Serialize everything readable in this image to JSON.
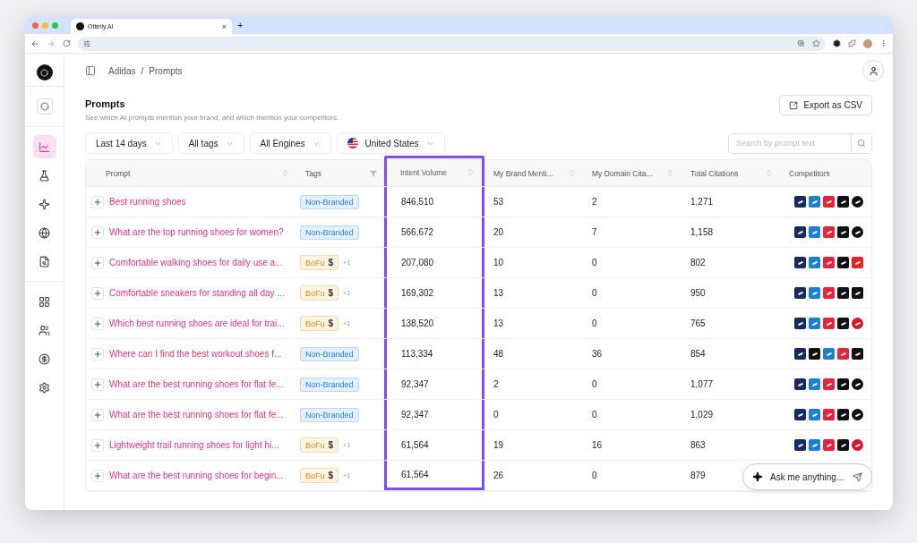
{
  "browser": {
    "tab_title": "Otterly.AI",
    "tab_close": "×",
    "new_tab": "+"
  },
  "sidebar": {
    "items": [
      {
        "selected": false
      },
      {
        "selected": true
      },
      {
        "selected": false
      },
      {
        "selected": false
      },
      {
        "selected": false
      },
      {
        "selected": false
      },
      {
        "selected": false
      },
      {
        "selected": false
      },
      {
        "selected": false
      },
      {
        "selected": false
      }
    ]
  },
  "breadcrumb": [
    {
      "label": "Adidas"
    },
    {
      "label": "/"
    },
    {
      "label": "Prompts"
    }
  ],
  "page": {
    "title": "Prompts",
    "subtitle": "See which AI prompts mention your brand, and which mention your competitors.",
    "export_button": "Export as CSV"
  },
  "filters": [
    {
      "label": "Last 14 days",
      "kind": "dropdown"
    },
    {
      "label": "All tags",
      "kind": "dropdown"
    },
    {
      "label": "All Engines",
      "kind": "dropdown"
    },
    {
      "label": "United States",
      "kind": "country"
    }
  ],
  "search": {
    "placeholder": "Search by prompt text"
  },
  "table": {
    "columns": [
      {
        "label": "Prompt",
        "kind": "sort",
        "highlighted": false
      },
      {
        "label": "Tags",
        "kind": "filter",
        "highlighted": false
      },
      {
        "label": "Intent Volume",
        "kind": "sort",
        "highlighted": true
      },
      {
        "label": "My Brand Menti...",
        "kind": "sort",
        "highlighted": false
      },
      {
        "label": "My Domain Cita...",
        "kind": "sort",
        "highlighted": false
      },
      {
        "label": "Total Citations",
        "kind": "sort",
        "highlighted": false
      },
      {
        "label": "Competitors",
        "kind": "none",
        "highlighted": false
      }
    ],
    "rows": [
      {
        "prompt": "Best running shoes",
        "tag": {
          "label": "Non-Branded",
          "kind": "non-branded"
        },
        "intent_volume": "846,510",
        "brand_mentions": "53",
        "domain_citations": "2",
        "total_citations": "1,271",
        "competitors": [
          {
            "color": "#1b2a5e",
            "kind": "square"
          },
          {
            "color": "#1d7fd0",
            "kind": "square"
          },
          {
            "color": "#e3243b",
            "kind": "square"
          },
          {
            "color": "#111111",
            "kind": "square"
          },
          {
            "color": "#111111",
            "kind": "circle"
          }
        ]
      },
      {
        "prompt": "What are the top running shoes for women?",
        "tag": {
          "label": "Non-Branded",
          "kind": "non-branded"
        },
        "intent_volume": "566,672",
        "brand_mentions": "20",
        "domain_citations": "7",
        "total_citations": "1,158",
        "competitors": [
          {
            "color": "#1b2a5e",
            "kind": "square"
          },
          {
            "color": "#1d7fd0",
            "kind": "square"
          },
          {
            "color": "#e3243b",
            "kind": "square"
          },
          {
            "color": "#111111",
            "kind": "square"
          },
          {
            "color": "#111111",
            "kind": "circle"
          }
        ]
      },
      {
        "prompt": "Comfortable walking shoes for daily use a...",
        "tag": {
          "label": "BoFu",
          "kind": "bofu",
          "symbol": "$"
        },
        "extra": "+1",
        "intent_volume": "207,080",
        "brand_mentions": "10",
        "domain_citations": "0",
        "total_citations": "802",
        "competitors": [
          {
            "color": "#1b2a5e",
            "kind": "square"
          },
          {
            "color": "#1d7fd0",
            "kind": "square"
          },
          {
            "color": "#e3243b",
            "kind": "square"
          },
          {
            "color": "#111111",
            "kind": "square"
          },
          {
            "color": "#e52320",
            "kind": "square"
          }
        ]
      },
      {
        "prompt": "Comfortable sneakers for standing all day ...",
        "tag": {
          "label": "BoFu",
          "kind": "bofu",
          "symbol": "$"
        },
        "extra": "+1",
        "intent_volume": "169,302",
        "brand_mentions": "13",
        "domain_citations": "0",
        "total_citations": "950",
        "competitors": [
          {
            "color": "#1b2a5e",
            "kind": "square"
          },
          {
            "color": "#1d7fd0",
            "kind": "square"
          },
          {
            "color": "#e3243b",
            "kind": "square"
          },
          {
            "color": "#111111",
            "kind": "square"
          },
          {
            "color": "#111111",
            "kind": "square"
          }
        ]
      },
      {
        "prompt": "Which best running shoes are ideal for trai...",
        "tag": {
          "label": "BoFu",
          "kind": "bofu",
          "symbol": "$"
        },
        "extra": "+1",
        "intent_volume": "138,520",
        "brand_mentions": "13",
        "domain_citations": "0",
        "total_citations": "765",
        "competitors": [
          {
            "color": "#1b2a5e",
            "kind": "square"
          },
          {
            "color": "#1d7fd0",
            "kind": "square"
          },
          {
            "color": "#e3243b",
            "kind": "square"
          },
          {
            "color": "#111111",
            "kind": "square"
          },
          {
            "color": "#d9172b",
            "kind": "circle"
          }
        ]
      },
      {
        "prompt": "Where can I find the best workout shoes f...",
        "tag": {
          "label": "Non-Branded",
          "kind": "non-branded"
        },
        "intent_volume": "113,334",
        "brand_mentions": "48",
        "domain_citations": "36",
        "total_citations": "854",
        "competitors": [
          {
            "color": "#1b2a5e",
            "kind": "square"
          },
          {
            "color": "#111111",
            "kind": "square"
          },
          {
            "color": "#1d7fd0",
            "kind": "square"
          },
          {
            "color": "#e3243b",
            "kind": "square"
          },
          {
            "color": "#111111",
            "kind": "square"
          }
        ]
      },
      {
        "prompt": "What are the best running shoes for flat fe...",
        "tag": {
          "label": "Non-Branded",
          "kind": "non-branded"
        },
        "intent_volume": "92,347",
        "brand_mentions": "2",
        "domain_citations": "0",
        "total_citations": "1,077",
        "competitors": [
          {
            "color": "#1b2a5e",
            "kind": "square"
          },
          {
            "color": "#1d7fd0",
            "kind": "square"
          },
          {
            "color": "#e3243b",
            "kind": "square"
          },
          {
            "color": "#111111",
            "kind": "square"
          },
          {
            "color": "#111111",
            "kind": "circle"
          }
        ]
      },
      {
        "prompt": "What are the best running shoes for flat fe...",
        "tag": {
          "label": "Non-Branded",
          "kind": "non-branded"
        },
        "intent_volume": "92,347",
        "brand_mentions": "0",
        "domain_citations": "0",
        "total_citations": "1,029",
        "competitors": [
          {
            "color": "#1b2a5e",
            "kind": "square"
          },
          {
            "color": "#1d7fd0",
            "kind": "square"
          },
          {
            "color": "#e3243b",
            "kind": "square"
          },
          {
            "color": "#111111",
            "kind": "square"
          },
          {
            "color": "#111111",
            "kind": "circle"
          }
        ]
      },
      {
        "prompt": "Lightweight trail running shoes for light hi...",
        "tag": {
          "label": "BoFu",
          "kind": "bofu",
          "symbol": "$"
        },
        "extra": "+1",
        "intent_volume": "61,564",
        "brand_mentions": "19",
        "domain_citations": "16",
        "total_citations": "863",
        "competitors": [
          {
            "color": "#1b2a5e",
            "kind": "square"
          },
          {
            "color": "#1d7fd0",
            "kind": "square"
          },
          {
            "color": "#e3243b",
            "kind": "square"
          },
          {
            "color": "#111111",
            "kind": "square"
          },
          {
            "color": "#d9172b",
            "kind": "circle"
          }
        ]
      },
      {
        "prompt": "What are the best running shoes for begin...",
        "tag": {
          "label": "BoFu",
          "kind": "bofu",
          "symbol": "$"
        },
        "extra": "+1",
        "intent_volume": "61,564",
        "brand_mentions": "26",
        "domain_citations": "0",
        "total_citations": "879",
        "competitors": []
      }
    ]
  },
  "chat": {
    "placeholder": "Ask me anything..."
  }
}
